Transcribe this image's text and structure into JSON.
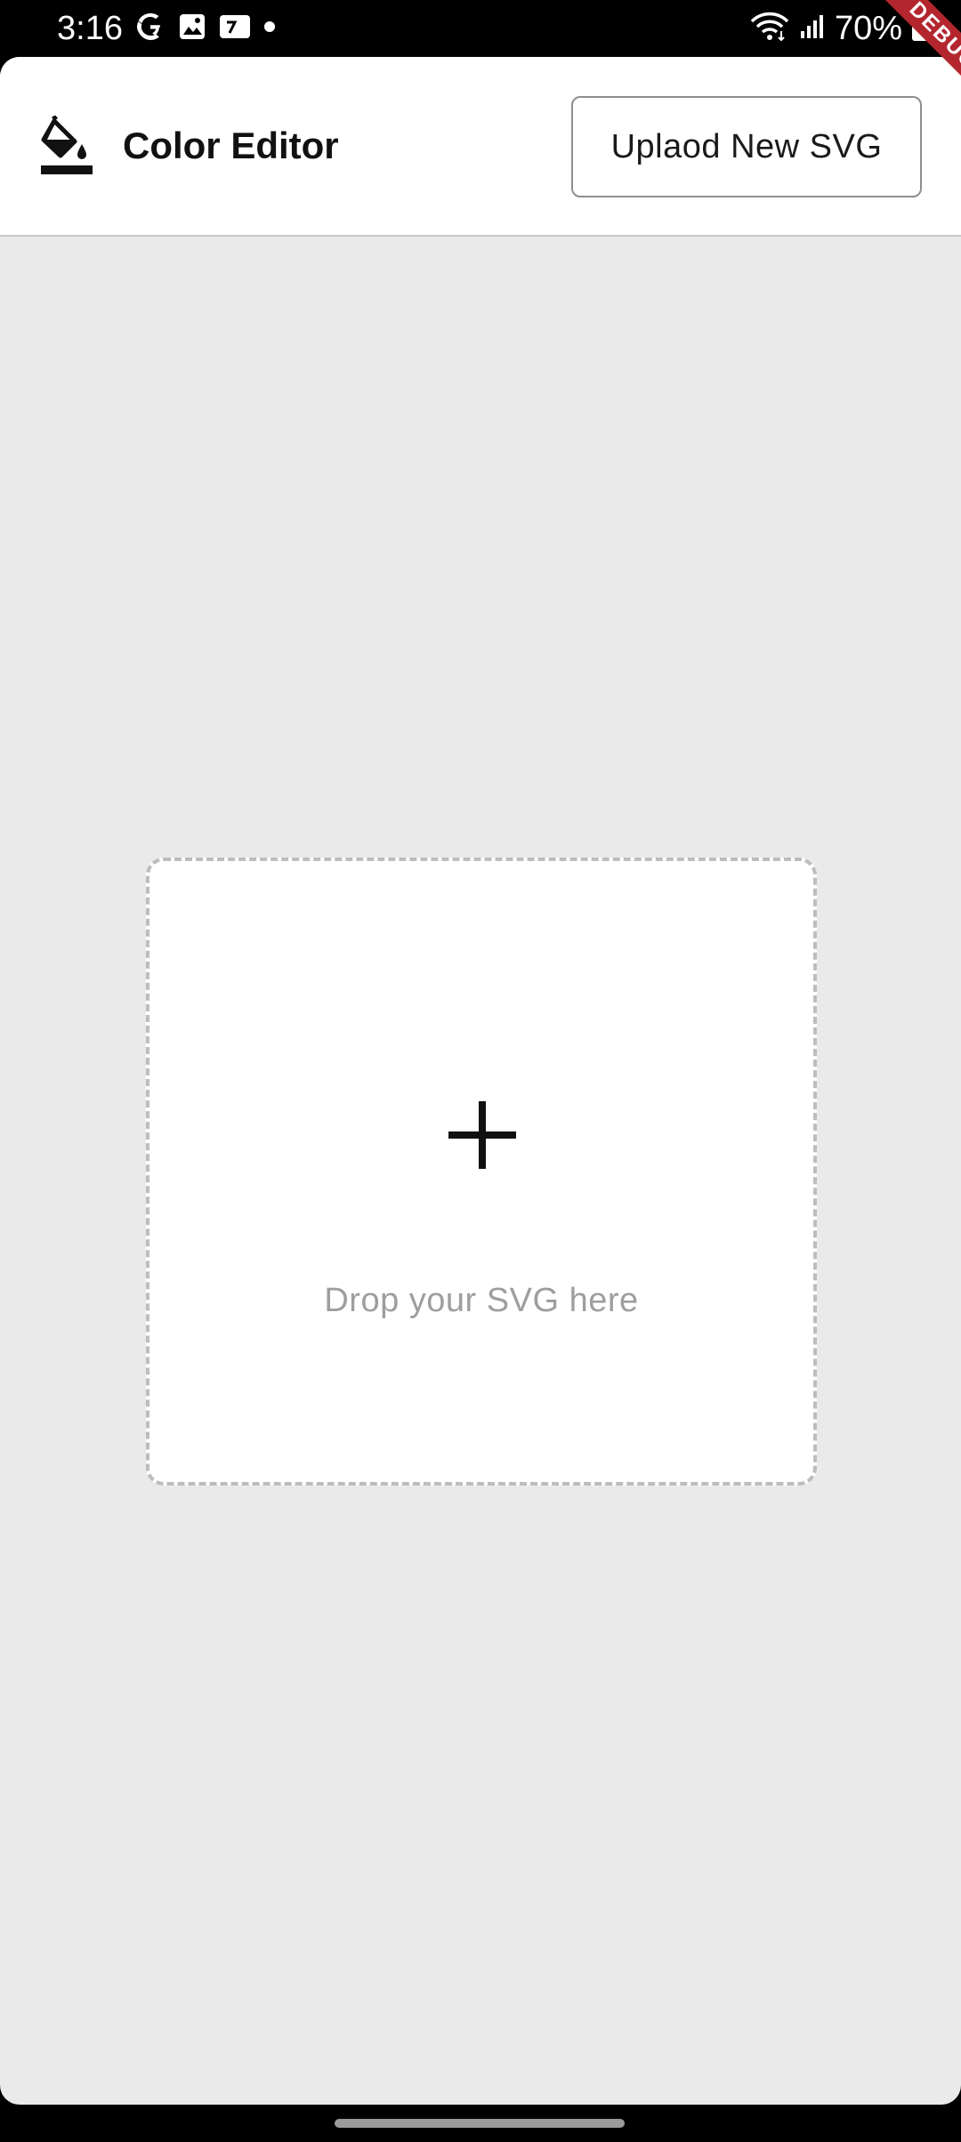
{
  "status_bar": {
    "time": "3:16",
    "battery": "70%",
    "left_icons": [
      "google-icon",
      "image-icon",
      "calendar-icon",
      "dot-icon"
    ],
    "right_icons": [
      "wifi-icon",
      "signal-icon",
      "battery-icon"
    ]
  },
  "app_bar": {
    "logo_icon": "format-color-fill-icon",
    "title": "Color Editor",
    "upload_label": "Uplaod New SVG"
  },
  "drop_zone": {
    "icon": "plus-icon",
    "text": "Drop your SVG here"
  },
  "debug_banner": {
    "label": "DEBUG",
    "color": "#b3262e"
  },
  "colors": {
    "app_background": "#eaeaea",
    "app_bar_background": "#ffffff",
    "status_bar_background": "#000000"
  }
}
